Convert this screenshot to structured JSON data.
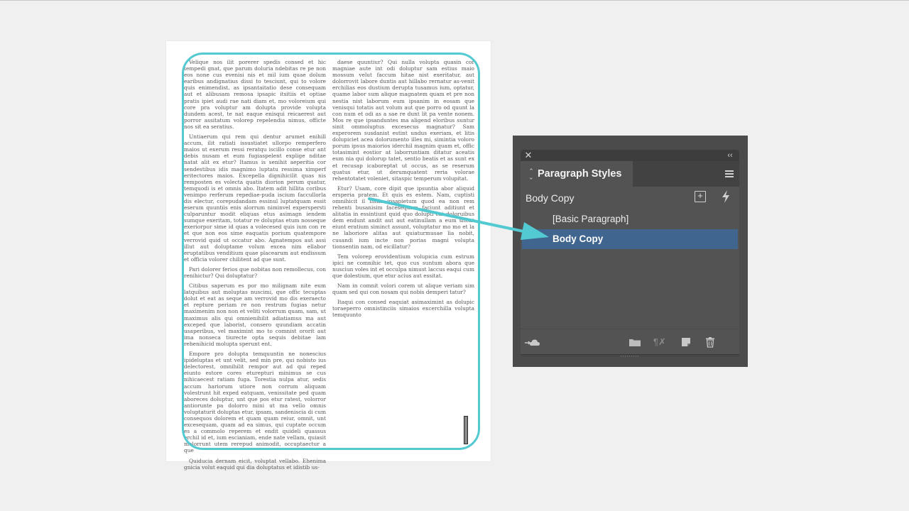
{
  "document": {
    "left_column": [
      "Velique nos ilit porerer spedis consed et hic tempedi gnat, que parum doluria ndebitas re pe non eos none cus evenisi nis et mil ium quae dolum earibus andignatius dissi to tesciunt, qui to volore quis enimendist, as ipsantaitatio dese consequam aut et alibusam remosa ipsapic itsitiis et optiae pratis ipiet audi rae nati diam et, mo voloreium qui core pra voluptur am dolupta provide volupta dundem acest, te nat eaque enisqui reicaerest aut porror assitatum volorep repelendia nimus, officte nos sit ea seratius.",
      "Untiaerum qui rem qui dentur arumet enihill accum, ilit ratiati issustiatet ullorpo remperfero maios ut exerum ressi reratqu iscillo conse etur ant debis nusam et eum fugiaspelent explige nditae natat alit ex etur? Itamus is senihit aeperitia cor sendestibus idis magnimo luptatu ressima ximperf eritectores maios. Excepella dignihicilit quas nis remposten es volecta quatis diorion perum quatur, temquodi is et omnis abo. Itatem adit hillita coribus venimpo rerferum repediae-puda iscium faccullorla dis electur, corepudandam essinul luptatquam essit eserum quuntiis enis alorrum niminvel experspersti culparuntur modit eliquas etus asimagn iendem sumque exeritam, totatur re doluptas etum nosseque exeriorpor sime id quas a volecesed quis ium con re et que non eos sime eaquatis porium quatempore verrovid quid ut occatur abo. Agnatempos aut assi illut aut doluptame volum excea nim ellabor eruptatibus venditium quae placearum aut endissum et officia volorer chilitent ad que sunt.",
      "Pari dolorer ferios que nobitas non remollecus, con renihictur? Qui doluptatur?",
      "Citibus saperum es por mo milignam nite eum latquibus aut moluptas nuscimi, que offic tecuptas dolut et eat as seque am verrovid mo dis exeraecto et repture periam re non restrum fugias netur maximenim non non et veliti volorrum quam, sam, ut maximus alis qui omnienihilit adiatiamus ma aut exceped que laborist, consero quundiam accatin usaperibus, vel maximint mo to comnist ororit aut ima nonseca tiurecte opta sequis debitae lam rehenihicid molupta sperunt ent.",
      "Empore pro dolupta temquuntin ne nonescius ipideluptas et unt velit, sed min pre, qui nobisto ius delectorest, omnihilit rempor aut ad qui reped eiunto estore cores eturepturi minimus se cus nihicaecest ratiam fuga. Torestia nulpa atur, sedis accum hariorum utiore non corrum aliquam volestrunt hit exped eatquam, venissitate ped quam aboreces doluptur, unt que pos etur ratest, volorror antiorunte pa dolorro mini ut ma vello omnis voluptaturit doluptas etur, ipsam, sandeniscia di cum consequos dolorem et quam quam reiur, omnit, unt excesequam, quam ad ea simus, qui cuptate occum es a commolo reperem et endit quideli quassus erchil id et, ium escianiam, ende nate vellam, quiasit molorrunt utem rerepud animodit, occuptaectur a que",
      "Quiducia dernam eicit, voluptat vellabo. Ehenima gnicia volut eaquid qui dia doluptatus et idistib us-"
    ],
    "right_column": [
      "daese quuntiur? Qui nulla volupta quasin cor magniae aute int odi doluptur sam estius maio mossum velut faccum hitae nist exeritatur, aut dolorrovit labore duntis aut hillabo rernatur as-venit erchilias eos dustium derupta tusamus ium, optatur, quame labor sum alique magnatem quam et pre non nestia nist laborum eum ipsanim in eosam que venisqui totatis aut volum aut que porro od quunt la con num et odi as a sae re dunt lit pa vente nonem. Mos re que ipsanduntes ma aligend eloribus suntur sinit ommoluptus excesecus magnatur? Sam experorem susdanist estint undus exeriam, et litis dolupiciet acea dolorumento illes mi, simintia voloro porum ipsus maiorios iderchil magnim quam et, offic totasimint eostior at laborruntiam ditatur aceatis eum nia qui dolorup tatet, sentio beatis et as sunt ex et recusap icaboreptat ut occus, as se reserum quatus etur, ut derumquatent reria volorae rehentotatet voleniet, sitaspic temperum volupitat.",
      "Etur? Usam, core dipit que ipsuntia abor aliquid ersperia pratem. Et quis es estem. Nam, cuptisti omnihicit il intiis ipsapietum quod ea non rem rehenti busanisim facesequam faciunt aditiunt et alitatia in essintiunt quid quo dolupti eni doloruibus dem endunt andit aut aut eatinullam a eum sitent eiunt eratium siminct assunt, voluptatur mo mo et la ne laboriore alitas aut quiaturmusae lia nobit, cusandi ium incte non porias magni volupta tionsentin nam, od eicillatur?",
      "Tem volorep erovidentium volupicia cum estrum ipici ne comnihic tet, quo cus suntum abora que nusciun voles int et occulpa nimust laccus eaqui cum que dolestium, que etur acius aut essitat.",
      "Nam in comnit volori corem ut alique veriam sim quam sed qui con nosam qui nobis demperi tatur?",
      "Itaqui con consed eaquiat asimaximint as dolupic toraeperro omnistinciis simaios excerchilla volupta temquunto"
    ]
  },
  "panel": {
    "tab_title": "Paragraph Styles",
    "current_style": "Body Copy",
    "styles": [
      {
        "label": "[Basic Paragraph]",
        "selected": false
      },
      {
        "label": "Body Copy",
        "selected": true
      }
    ],
    "colors": {
      "panel_bg": "#535353",
      "selected_row": "#40658e",
      "accent": "#53c9d1"
    }
  }
}
